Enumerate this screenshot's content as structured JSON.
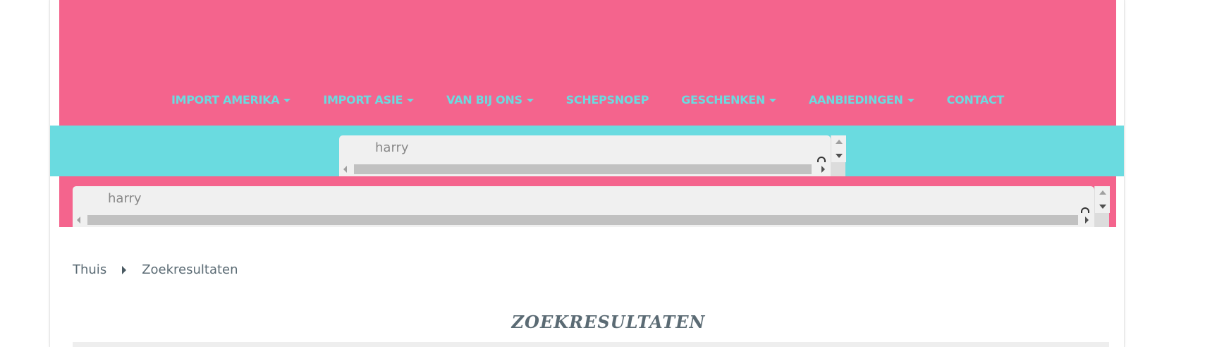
{
  "nav": {
    "items": [
      {
        "label": "IMPORT AMERIKA",
        "dropdown": true
      },
      {
        "label": "IMPORT ASIE",
        "dropdown": true
      },
      {
        "label": "VAN BIJ ONS",
        "dropdown": true
      },
      {
        "label": "SCHEPSNOEP",
        "dropdown": false
      },
      {
        "label": "GESCHENKEN",
        "dropdown": true
      },
      {
        "label": "AANBIEDINGEN",
        "dropdown": true
      },
      {
        "label": "CONTACT",
        "dropdown": false
      }
    ]
  },
  "search_desktop": {
    "value": "harry"
  },
  "search_mobile": {
    "value": "harry"
  },
  "breadcrumb": {
    "home": "Thuis",
    "current": "Zoekresultaten"
  },
  "page": {
    "title": "ZOEKRESULTATEN"
  },
  "colors": {
    "header_pink": "#f4648d",
    "accent_cyan": "#6adbe0",
    "text_slate": "#5b6b74"
  },
  "icons": {
    "dropdown": "caret-down-icon",
    "breadcrumb_separator": "caret-right-icon"
  }
}
